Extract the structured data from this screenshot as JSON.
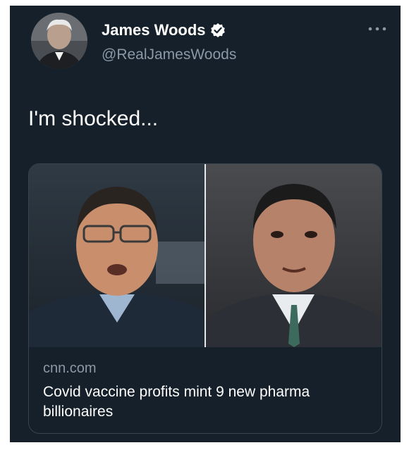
{
  "tweet": {
    "author": {
      "display_name": "James Woods",
      "handle": "@RealJamesWoods",
      "verified": true
    },
    "text": "I'm shocked...",
    "menu_icon": "more-icon"
  },
  "link_card": {
    "domain": "cnn.com",
    "title": "Covid vaccine profits mint 9 new pharma billionaires"
  },
  "colors": {
    "background": "#15202b",
    "text_primary": "#ffffff",
    "text_secondary": "#8b98a5",
    "border": "#38444d",
    "verified": "#ffffff"
  }
}
